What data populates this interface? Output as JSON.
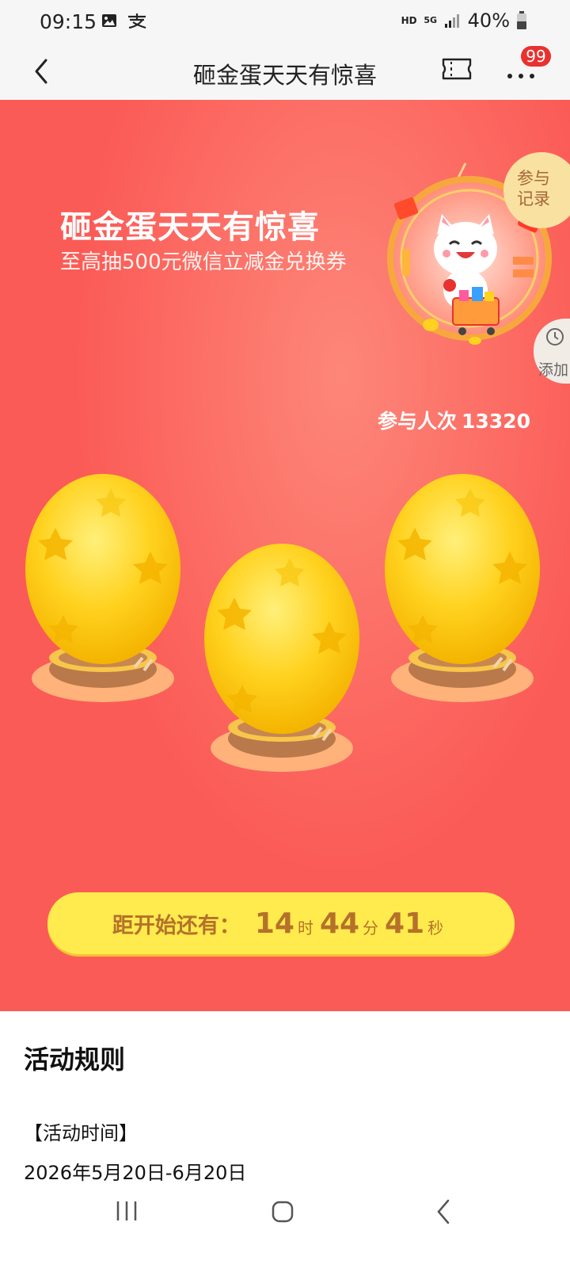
{
  "status_bar": {
    "time": "09:15",
    "icons": [
      "image-icon",
      "alipay-icon"
    ],
    "hd": "HD",
    "network": "5G",
    "battery": "40%"
  },
  "nav": {
    "title": "砸金蛋天天有惊喜",
    "badge": "99",
    "icons": [
      "back-arrow-icon",
      "ticket-icon",
      "more-icon"
    ]
  },
  "hero": {
    "title": "砸金蛋天天有惊喜",
    "subtitle": "至高抽500元微信立减金兑换券",
    "record_button": {
      "line1": "参与",
      "line2": "记录"
    },
    "add_button": {
      "label": "添加"
    },
    "participants_label": "参与人次",
    "participants_count": "13320"
  },
  "countdown": {
    "label": "距开始还有：",
    "hours": "14",
    "hours_unit": "时",
    "minutes": "44",
    "minutes_unit": "分",
    "seconds": "41",
    "seconds_unit": "秒"
  },
  "rules": {
    "title": "活动规则",
    "time_heading": "【活动时间】",
    "time_value": "2026年5月20日-6月20日"
  },
  "colors": {
    "hero_bg": "#fb5b56",
    "egg_yellow": "#ffd21f",
    "countdown_bg": "#ffeb4d",
    "countdown_text": "#b5712a",
    "badge_red": "#e8322f"
  }
}
